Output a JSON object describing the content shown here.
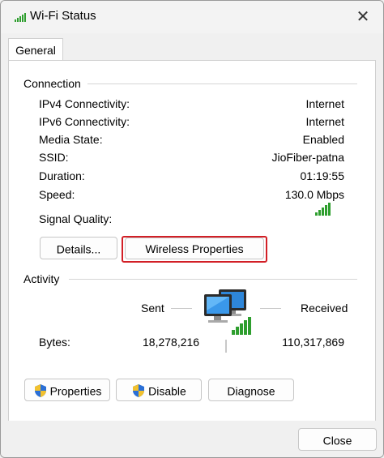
{
  "window": {
    "title": "Wi-Fi Status"
  },
  "tabs": [
    {
      "label": "General"
    }
  ],
  "connection": {
    "group_label": "Connection",
    "rows": [
      {
        "label": "IPv4 Connectivity:",
        "value": "Internet"
      },
      {
        "label": "IPv6 Connectivity:",
        "value": "Internet"
      },
      {
        "label": "Media State:",
        "value": "Enabled"
      },
      {
        "label": "SSID:",
        "value": "JioFiber-patna"
      },
      {
        "label": "Duration:",
        "value": "01:19:55"
      },
      {
        "label": "Speed:",
        "value": "130.0 Mbps"
      }
    ],
    "signal_quality_label": "Signal Quality:",
    "details_button": "Details...",
    "wireless_properties_button": "Wireless Properties"
  },
  "activity": {
    "group_label": "Activity",
    "sent_label": "Sent",
    "received_label": "Received",
    "bytes_label": "Bytes:",
    "bytes_sent": "18,278,216",
    "bytes_received": "110,317,869"
  },
  "actions": {
    "properties_button": "Properties",
    "disable_button": "Disable",
    "diagnose_button": "Diagnose"
  },
  "footer": {
    "close_button": "Close"
  },
  "colors": {
    "signal_green": "#2e9e2e",
    "highlight_red": "#d21f26",
    "shield_blue": "#2a6fd6",
    "shield_yellow": "#f2c12e"
  }
}
